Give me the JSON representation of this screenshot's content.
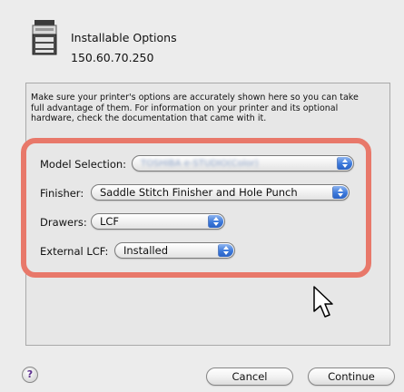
{
  "header": {
    "title": "Installable Options",
    "address": "150.60.70.250",
    "icon": "printer-icon"
  },
  "instructions": {
    "line1": "Make sure your printer's options are accurately shown here so you can take",
    "line2": "full advantage of them.  For information on your printer and its optional",
    "line3": "hardware, check the documentation that came with it."
  },
  "fields": {
    "model": {
      "label": "Model Selection:",
      "value": "TOSHIBA e-STUDIO(Color)"
    },
    "finisher": {
      "label": "Finisher:",
      "value": "Saddle Stitch Finisher and Hole Punch"
    },
    "drawers": {
      "label": "Drawers:",
      "value": "LCF"
    },
    "external_lcf": {
      "label": "External LCF:",
      "value": "Installed"
    }
  },
  "buttons": {
    "help": "?",
    "cancel": "Cancel",
    "continue": "Continue"
  },
  "colors": {
    "highlight": "#e8786a",
    "popup_arrow": "#3c79db"
  }
}
